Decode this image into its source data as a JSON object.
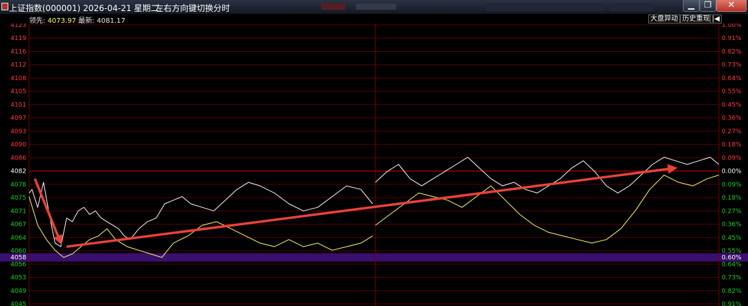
{
  "window": {
    "title": "上证指数(000001) 2026-04-21 星期二",
    "hint": "左右方向键切换分时",
    "min_glyph": "▁",
    "max_glyph": "❐",
    "close_glyph": "✕"
  },
  "info": {
    "leader_label": "领先:",
    "leader_value": "4073.97",
    "latest_label": "最新:",
    "latest_value": "4081.17",
    "btn_market_move": "大盘异动",
    "btn_history_replay": "历史重现",
    "btn_back_glyph": "|◀"
  },
  "colors": {
    "up": "#ff3b3b",
    "down": "#19d219",
    "neutral": "#ffffff",
    "grid": "#5a0000",
    "price_line": "#ffffff",
    "avg_line": "#ffff66",
    "arrow": "#e8433a",
    "highlight": "#3a0f6e"
  },
  "chart_data": {
    "type": "line",
    "title": "",
    "xlabel": "",
    "ylabel": "",
    "prev_close": 4082,
    "ylim": [
      4045,
      4123
    ],
    "current_value": 4058,
    "left_ticks": [
      "4123",
      "4119",
      "4116",
      "4112",
      "4108",
      "4105",
      "4101",
      "4097",
      "4093",
      "4090",
      "4086",
      "4082",
      "4078",
      "4075",
      "4071",
      "4067",
      "4064",
      "4060",
      "4056",
      "4053",
      "4049",
      "4045"
    ],
    "right_ticks": [
      "1.00%",
      "0.91%",
      "0.82%",
      "0.73%",
      "0.64%",
      "0.55%",
      "0.45%",
      "0.36%",
      "0.27%",
      "0.18%",
      "0.09%",
      "0.00%",
      "0.09%",
      "0.18%",
      "0.27%",
      "0.36%",
      "0.45%",
      "0.55%",
      "0.64%",
      "0.73%",
      "0.82%",
      "0.91%"
    ],
    "current_left_label": "4058",
    "current_right_label": "0.60%",
    "series": [
      {
        "x": [
          0,
          1,
          3,
          5,
          7,
          9,
          11,
          13,
          15,
          17,
          19,
          21,
          23,
          25,
          27,
          29,
          31,
          33,
          35,
          38,
          41,
          44,
          47,
          50,
          53,
          56,
          60,
          64,
          68,
          72,
          76,
          80,
          85,
          90,
          95,
          100,
          105,
          110,
          115,
          119
        ],
        "values": [
          4076,
          4077,
          4072,
          4079,
          4070,
          4062,
          4061,
          4069,
          4068,
          4071,
          4072,
          4070,
          4071,
          4069,
          4068,
          4067,
          4066,
          4064,
          4063,
          4066,
          4068,
          4069,
          4073,
          4074,
          4075,
          4073,
          4072,
          4071,
          4074,
          4077,
          4079,
          4078,
          4076,
          4073,
          4071,
          4072,
          4075,
          4078,
          4077,
          4073
        ]
      },
      {
        "x": [
          120,
          124,
          128,
          132,
          136,
          140,
          144,
          148,
          152,
          156,
          160,
          164,
          168,
          172,
          176,
          180,
          184,
          188,
          192,
          196,
          200,
          204,
          208,
          212,
          216,
          220,
          224,
          228,
          232,
          236,
          239
        ],
        "values": [
          4079,
          4082,
          4084,
          4080,
          4078,
          4080,
          4082,
          4084,
          4086,
          4083,
          4080,
          4078,
          4079,
          4077,
          4076,
          4078,
          4080,
          4083,
          4085,
          4082,
          4078,
          4076,
          4078,
          4081,
          4084,
          4086,
          4085,
          4084,
          4085,
          4086,
          4084
        ]
      },
      {
        "x": [
          0,
          3,
          6,
          9,
          12,
          15,
          18,
          21,
          24,
          27,
          30,
          34,
          38,
          42,
          46,
          50,
          55,
          60,
          65,
          70,
          75,
          80,
          85,
          90,
          95,
          100,
          105,
          110,
          115,
          119
        ],
        "values": [
          4075,
          4067,
          4063,
          4060,
          4058,
          4059,
          4061,
          4063,
          4064,
          4066,
          4063,
          4061,
          4060,
          4059,
          4058,
          4062,
          4064,
          4067,
          4068,
          4066,
          4064,
          4062,
          4061,
          4063,
          4061,
          4062,
          4060,
          4061,
          4062,
          4064
        ]
      },
      {
        "x": [
          120,
          125,
          130,
          135,
          140,
          145,
          150,
          155,
          160,
          165,
          170,
          175,
          180,
          185,
          190,
          195,
          200,
          205,
          210,
          215,
          220,
          225,
          230,
          235,
          239
        ],
        "values": [
          4067,
          4070,
          4073,
          4076,
          4075,
          4074,
          4072,
          4075,
          4078,
          4074,
          4070,
          4067,
          4065,
          4064,
          4063,
          4062,
          4063,
          4066,
          4071,
          4077,
          4081,
          4079,
          4078,
          4080,
          4081
        ]
      }
    ],
    "annotations": [
      {
        "type": "arrow",
        "from": [
          2,
          4080
        ],
        "to": [
          11,
          4062
        ]
      },
      {
        "type": "arrow",
        "from": [
          13,
          4061
        ],
        "to": [
          224,
          4083
        ]
      }
    ]
  }
}
